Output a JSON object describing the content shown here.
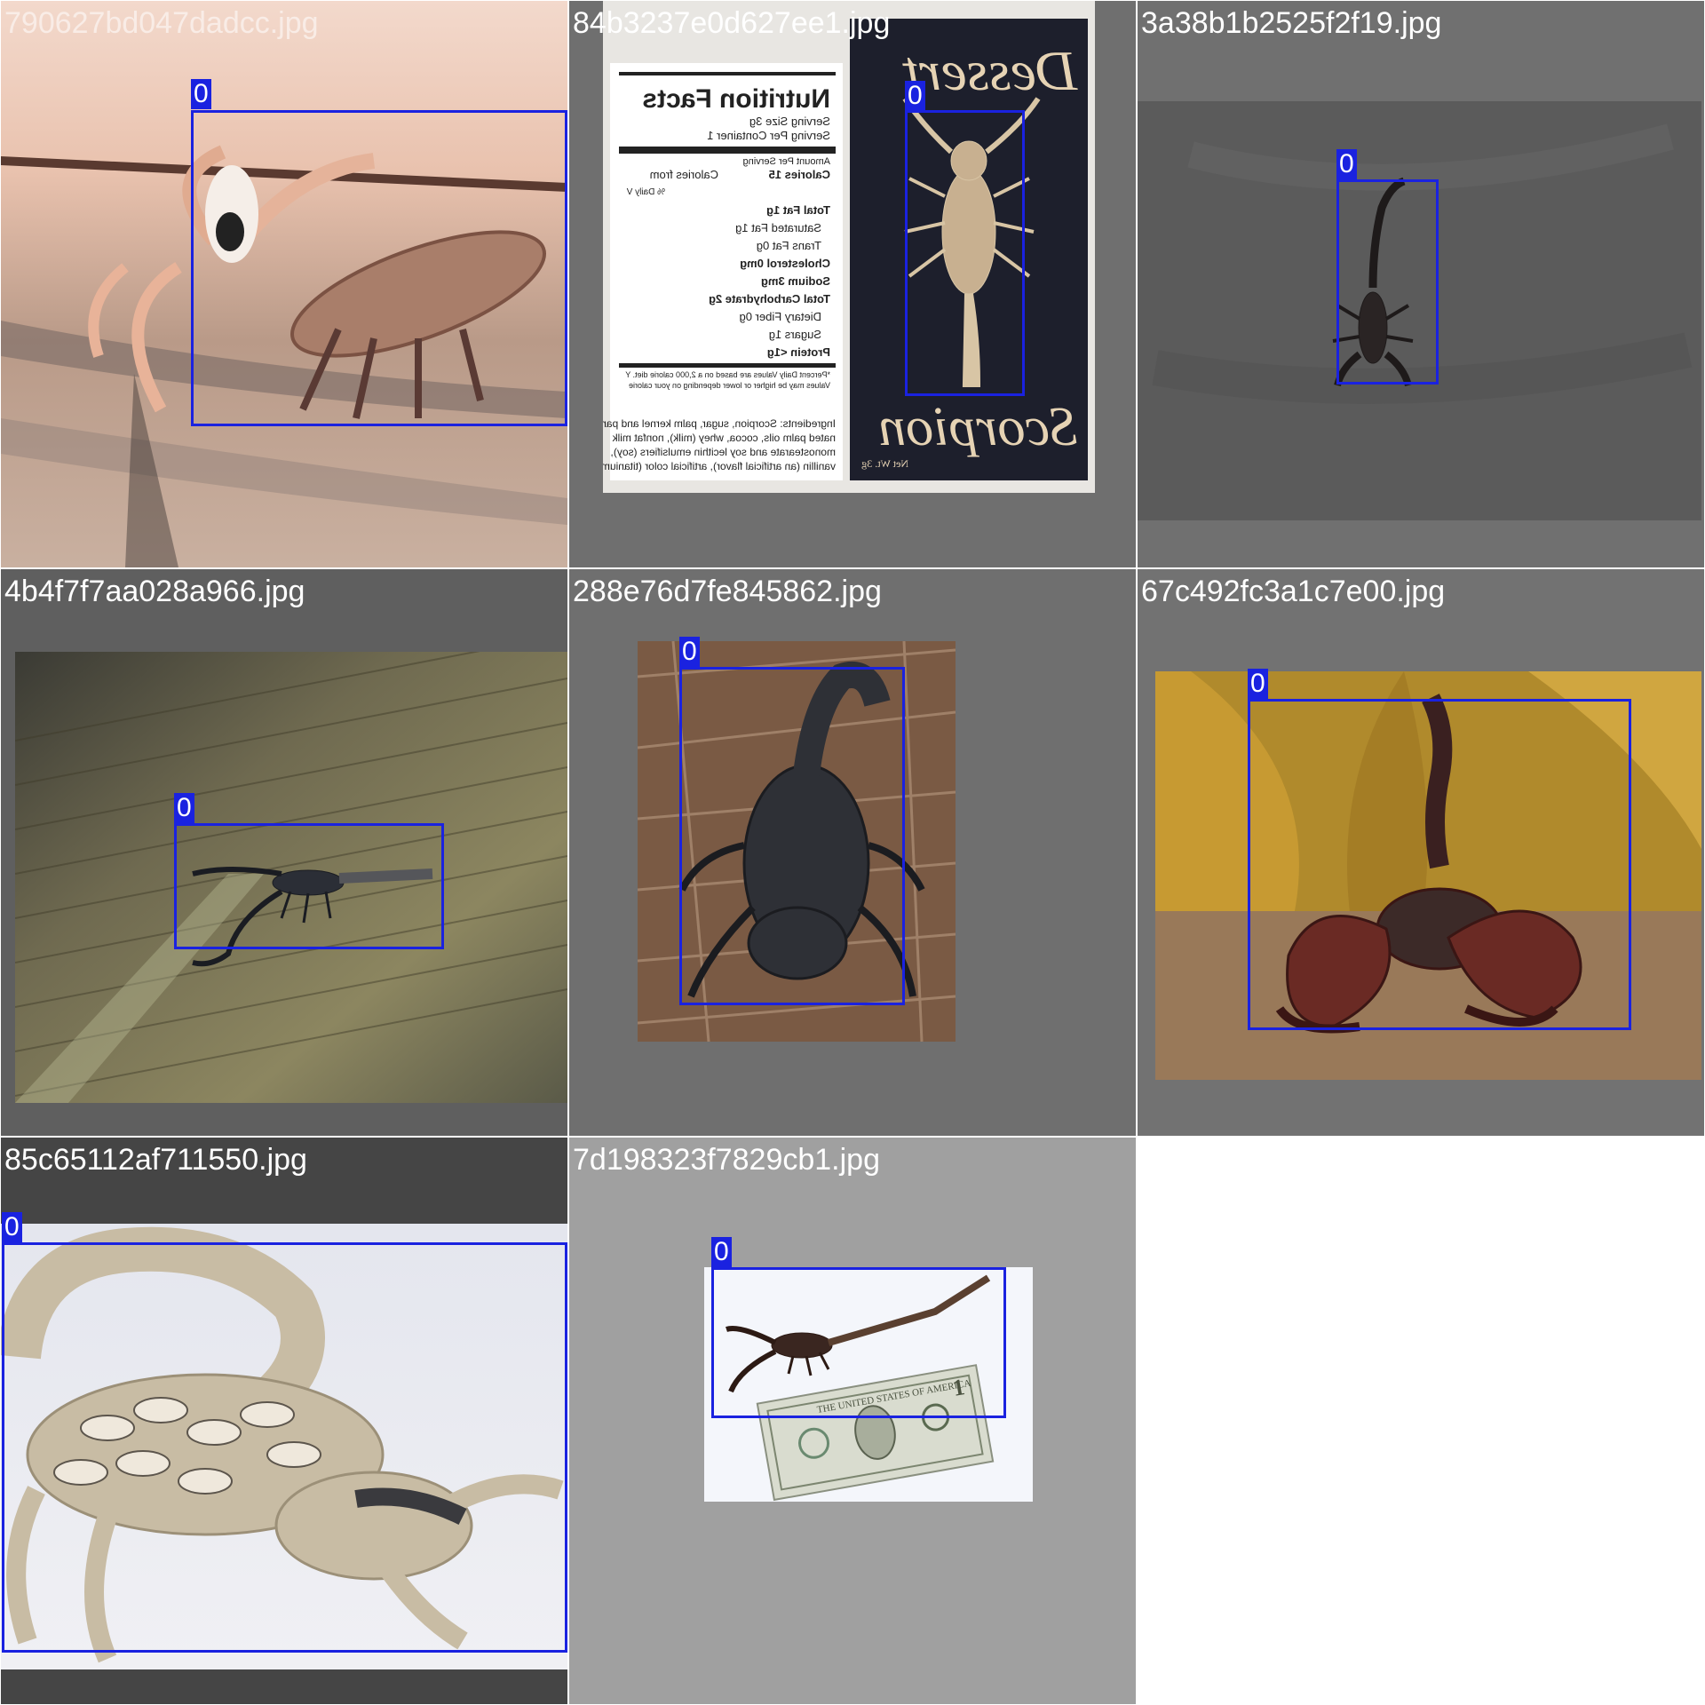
{
  "tiles": [
    {
      "filename": "790627bd047dadcc.jpg",
      "label": "0"
    },
    {
      "filename": "84b3237e0d627ee1.jpg",
      "label": "0"
    },
    {
      "filename": "3a38b1b2525f2f19.jpg",
      "label": "0"
    },
    {
      "filename": "4b4f7f7aa028a966.jpg",
      "label": "0"
    },
    {
      "filename": "288e76d7fe845862.jpg",
      "label": "0"
    },
    {
      "filename": "67c492fc3a1c7e00.jpg",
      "label": "0"
    },
    {
      "filename": "85c65112af711550.jpg",
      "label": "0"
    },
    {
      "filename": "7d198323f7829cb1.jpg",
      "label": "0"
    }
  ],
  "box_color": "#1a22e0",
  "package": {
    "nutrition_title": "Nutrition Facts",
    "serving_size": "Serving Size 3g",
    "servings": "Serving Per Container 1",
    "amount": "Amount Per Serving",
    "calories": "Calories 15",
    "calories_from": "Calories from",
    "daily": "% Daily V",
    "rows": [
      "Total Fat 1g",
      "Saturated Fat 1g",
      "Trans Fat 0g",
      "Cholesterol 0mg",
      "Sodium 3mg",
      "Total Carbohydrate 2g",
      "Dietary Fiber 0g",
      "Sugars 1g",
      "Protein <1g"
    ],
    "footnote1": "*Percent Daily Values are based on a 2,000 calorie diet. Y",
    "footnote2": "Values may be higher or lower depending on your calorie",
    "ingredients1": "Ingredients: Scorpion, sugar, palm kernel and partially",
    "ingredients2": "nated palm oils, cocoa, whey (milk), nonfat milk",
    "ingredients3": "monostearate and soy lecithin emulsifiers (soy),",
    "ingredients4": "vanillin (an artificial flavor), artificial color (titanium d",
    "brand_top": "Dessert",
    "brand_bottom": "Scorpion",
    "net_wt": "Net Wt. 3g"
  },
  "bill": {
    "header": "THE UNITED STATES OF AMERICA",
    "value": "1"
  }
}
